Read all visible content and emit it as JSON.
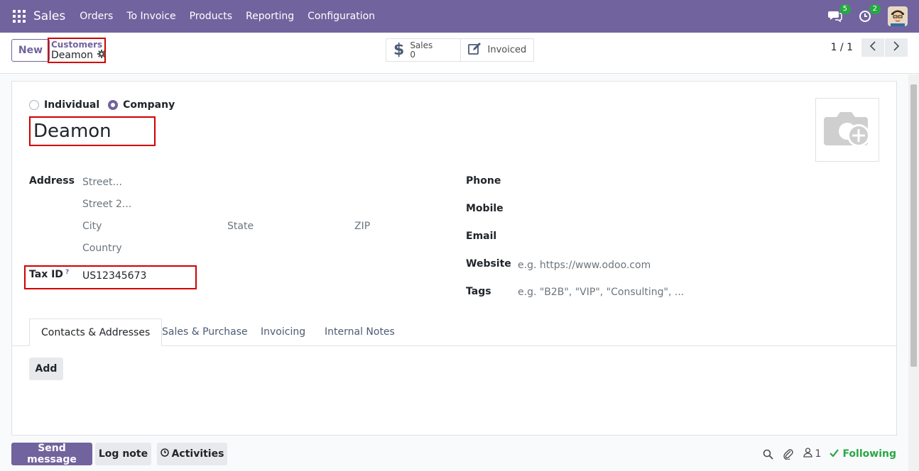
{
  "navbar": {
    "app_name": "Sales",
    "menu": [
      "Orders",
      "To Invoice",
      "Products",
      "Reporting",
      "Configuration"
    ],
    "messages_count": "5",
    "activities_count": "2"
  },
  "control": {
    "new_label": "New",
    "breadcrumb_parent": "Customers",
    "breadcrumb_current": "Deamon",
    "smart_sales_label": "Sales",
    "smart_sales_value": "0",
    "smart_invoiced_label": "Invoiced",
    "pager_value": "1 / 1"
  },
  "form": {
    "type_individual": "Individual",
    "type_company": "Company",
    "name": "Deamon",
    "address_label": "Address",
    "street_placeholder": "Street...",
    "street2_placeholder": "Street 2...",
    "city_placeholder": "City",
    "state_placeholder": "State",
    "zip_placeholder": "ZIP",
    "country_placeholder": "Country",
    "tax_id_label": "Tax ID",
    "tax_id_help": "?",
    "tax_id_value": "US12345673",
    "phone_label": "Phone",
    "mobile_label": "Mobile",
    "email_label": "Email",
    "website_label": "Website",
    "website_placeholder": "e.g. https://www.odoo.com",
    "tags_label": "Tags",
    "tags_placeholder": "e.g. \"B2B\", \"VIP\", \"Consulting\", ..."
  },
  "tabs": [
    "Contacts & Addresses",
    "Sales & Purchase",
    "Invoicing",
    "Internal Notes"
  ],
  "add_label": "Add",
  "chatter": {
    "send_message": "Send message",
    "log_note": "Log note",
    "activities": "Activities",
    "followers_count": "1",
    "following": "Following"
  },
  "colors": {
    "brand": "#71639e",
    "highlight": "#d00000",
    "success": "#28a745"
  }
}
